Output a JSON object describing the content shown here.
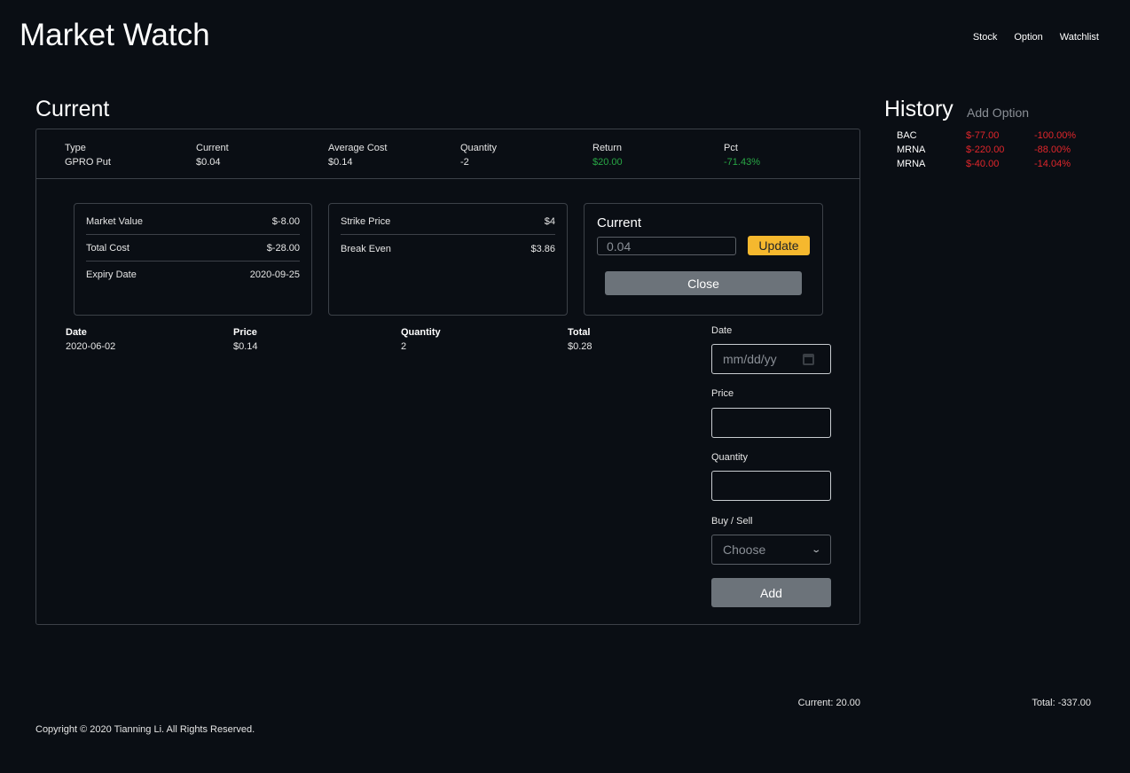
{
  "brand": "Market Watch",
  "nav": [
    "Stock",
    "Option",
    "Watchlist"
  ],
  "current_heading": "Current",
  "history_heading": "History",
  "add_option_label": "Add Option",
  "summary": {
    "type_label": "Type",
    "type_value": "GPRO Put",
    "current_label": "Current",
    "current_value": "$0.04",
    "avg_cost_label": "Average Cost",
    "avg_cost_value": "$0.14",
    "quantity_label": "Quantity",
    "quantity_value": "-2",
    "return_label": "Return",
    "return_value": "$20.00",
    "pct_label": "Pct",
    "pct_value": "-71.43%"
  },
  "details": {
    "market_value_label": "Market Value",
    "market_value": "$-8.00",
    "total_cost_label": "Total Cost",
    "total_cost": "$-28.00",
    "expiry_label": "Expiry Date",
    "expiry": "2020-09-25",
    "strike_label": "Strike Price",
    "strike": "$4",
    "break_even_label": "Break Even",
    "break_even": "$3.86"
  },
  "update_panel": {
    "title": "Current",
    "input_value": "0.04",
    "update_label": "Update",
    "close_label": "Close"
  },
  "transactions": {
    "headers": [
      "Date",
      "Price",
      "Quantity",
      "Total"
    ],
    "rows": [
      [
        "2020-06-02",
        "$0.14",
        "2",
        "$0.28"
      ]
    ]
  },
  "form": {
    "date_label": "Date",
    "date_placeholder": "mm/dd/yy",
    "price_label": "Price",
    "quantity_label": "Quantity",
    "buysell_label": "Buy / Sell",
    "buysell_value": "Choose",
    "add_label": "Add"
  },
  "history": [
    {
      "symbol": "BAC",
      "amount": "$-77.00",
      "pct": "-100.00%"
    },
    {
      "symbol": "MRNA",
      "amount": "$-220.00",
      "pct": "-88.00%"
    },
    {
      "symbol": "MRNA",
      "amount": "$-40.00",
      "pct": "-14.04%"
    }
  ],
  "footer": {
    "current": "Current: 20.00",
    "total": "Total: -337.00",
    "copyright": "Copyright © 2020 Tianning Li. All Rights Reserved."
  },
  "colors": {
    "accent": "#f5b82e",
    "positive": "#28a745",
    "negative": "#e0262b",
    "background": "#0a0e14"
  }
}
